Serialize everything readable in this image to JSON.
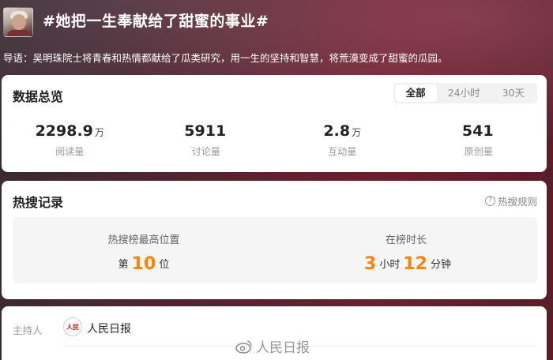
{
  "topic": {
    "title": "#她把一生奉献给了甜蜜的事业#",
    "intro": "导语：吴明珠院士将青春和热情都献给了瓜类研究，用一生的坚持和智慧，将荒漠变成了甜蜜的瓜园。"
  },
  "overview": {
    "title": "数据总览",
    "tabs": [
      {
        "label": "全部",
        "active": true
      },
      {
        "label": "24小时",
        "active": false
      },
      {
        "label": "30天",
        "active": false
      }
    ],
    "stats": [
      {
        "value": "2298.9",
        "unit": "万",
        "label": "阅读量"
      },
      {
        "value": "5911",
        "unit": "",
        "label": "讨论量"
      },
      {
        "value": "2.8",
        "unit": "万",
        "label": "互动量"
      },
      {
        "value": "541",
        "unit": "",
        "label": "原创量"
      }
    ]
  },
  "hot_search": {
    "title": "热搜记录",
    "rules_link": "热搜规则",
    "rules_icon": "question-circle-icon",
    "highest_position": {
      "label": "热搜榜最高位置",
      "prefix": "第",
      "value": "10",
      "suffix": "位"
    },
    "duration": {
      "label": "在榜时长",
      "hours": "3",
      "hours_unit": "小时",
      "minutes": "12",
      "minutes_unit": "分钟"
    }
  },
  "host": {
    "label": "主持人",
    "name": "人民日报",
    "logo_text": "人民日報"
  },
  "watermark": {
    "text": "人民日报",
    "icon": "weibo-icon"
  },
  "colors": {
    "accent": "#ff8200",
    "header_bg": "#5a2230",
    "card_bg": "#ffffff",
    "panel_bg": "#f5f5f5"
  }
}
